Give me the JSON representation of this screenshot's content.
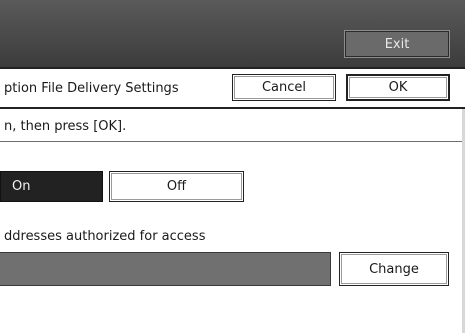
{
  "header": {
    "exit_label": "Exit"
  },
  "title_bar": {
    "title": "ption File Delivery Settings",
    "cancel_label": "Cancel",
    "ok_label": "OK"
  },
  "instruction": "n, then press [OK].",
  "toggle": {
    "on_label": "On",
    "off_label": "Off",
    "selected": "On"
  },
  "address": {
    "label": "ddresses authorized for access",
    "value": "",
    "change_label": "Change"
  },
  "colors": {
    "top_bar": "#484848",
    "selected_button": "#222222",
    "address_field": "#707070"
  }
}
